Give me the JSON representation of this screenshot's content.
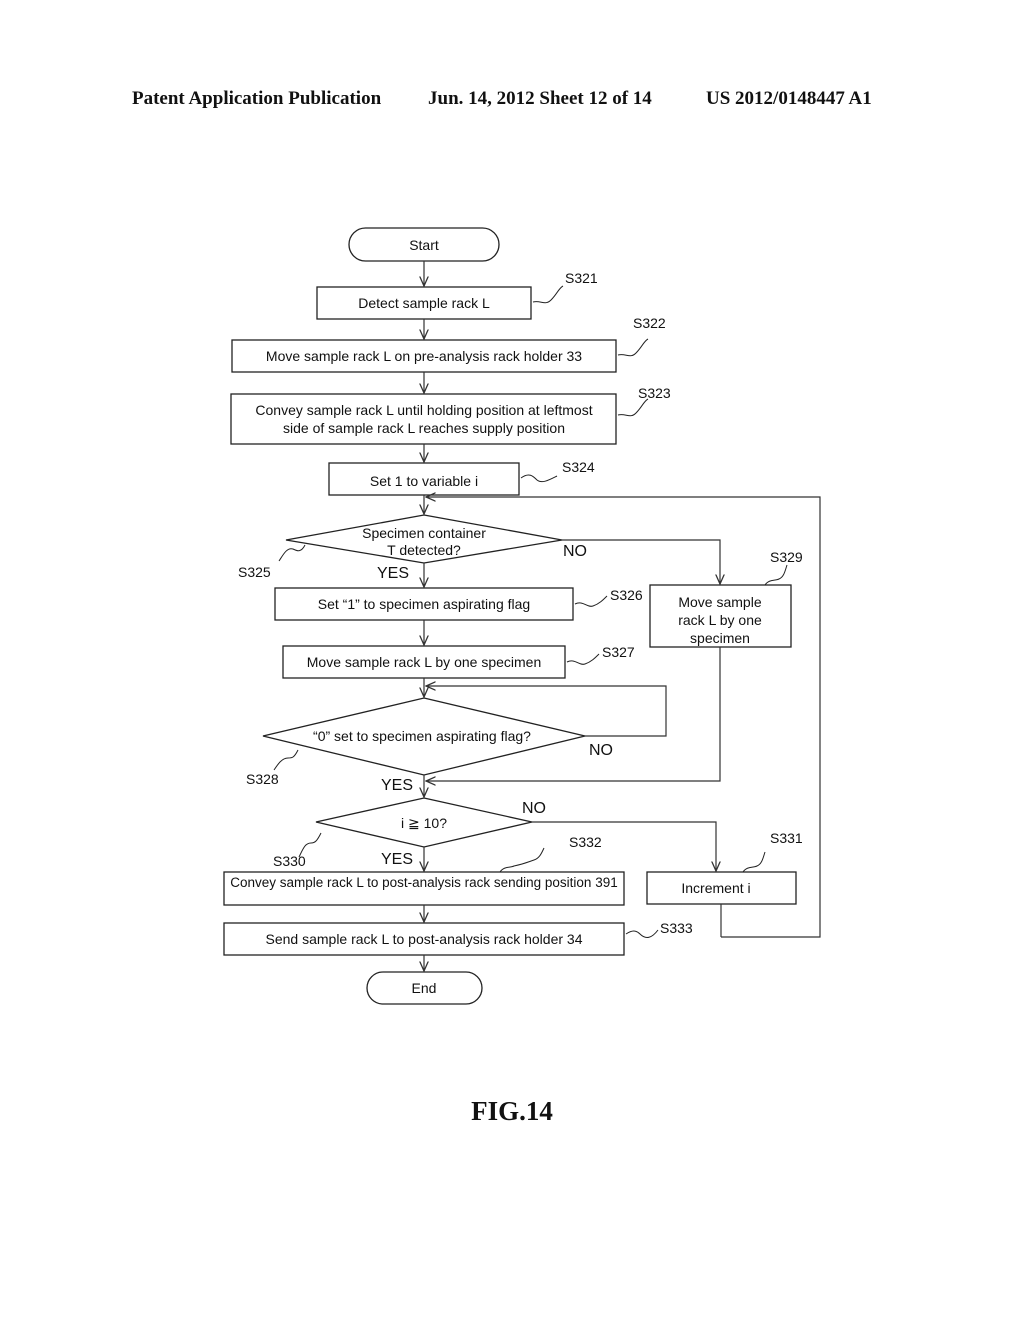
{
  "header": {
    "publication": "Patent Application Publication",
    "date_sheet": "Jun. 14, 2012  Sheet 12 of 14",
    "number": "US 2012/0148447 A1"
  },
  "flowchart": {
    "start": "Start",
    "end": "End",
    "steps": {
      "s321": {
        "label": "S321",
        "text": "Detect sample rack L"
      },
      "s322": {
        "label": "S322",
        "text": "Move sample rack L on pre-analysis rack holder 33"
      },
      "s323": {
        "label": "S323",
        "line1": "Convey sample rack L until holding position at leftmost",
        "line2": "side of sample rack L reaches supply position"
      },
      "s324": {
        "label": "S324",
        "text": "Set 1 to variable i"
      },
      "s325": {
        "label": "S325",
        "line1": "Specimen container",
        "line2": "T detected?"
      },
      "s326": {
        "label": "S326",
        "text": "Set “1” to specimen aspirating flag"
      },
      "s327": {
        "label": "S327",
        "text": "Move sample rack L by one specimen"
      },
      "s328": {
        "label": "S328",
        "text": "“0” set to specimen aspirating flag?"
      },
      "s329": {
        "label": "S329",
        "line1": "Move sample",
        "line2": "rack L by one",
        "line3": "specimen"
      },
      "s330": {
        "label": "S330",
        "text": "i ≧ 10?"
      },
      "s331": {
        "label": "S331",
        "text": "Increment i"
      },
      "s332": {
        "label": "S332",
        "text": "Convey sample rack L to post-analysis rack sending position 391"
      },
      "s333": {
        "label": "S333",
        "text": "Send sample rack L to post-analysis rack holder 34"
      }
    },
    "branches": {
      "yes": "YES",
      "no": "NO"
    }
  },
  "figure_caption": "FIG.14"
}
